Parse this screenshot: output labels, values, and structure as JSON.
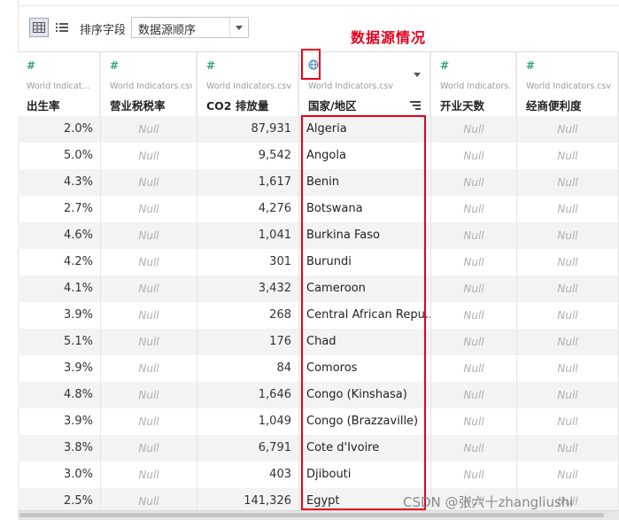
{
  "toolbar": {
    "sort_label": "排序字段",
    "sort_value": "数据源顺序"
  },
  "annotation": "数据源情况",
  "columns": [
    {
      "key": "birth",
      "type_icon": "#",
      "source": "World Indicat...",
      "name": "出生率"
    },
    {
      "key": "tax",
      "type_icon": "#",
      "source": "World Indicators.csv",
      "name": "营业税税率"
    },
    {
      "key": "co2",
      "type_icon": "#",
      "source": "World Indicators.csv",
      "name": "CO2 排放量"
    },
    {
      "key": "country",
      "type_icon": "globe",
      "source": "World Indicators.csv",
      "name": "国家/地区"
    },
    {
      "key": "days",
      "type_icon": "#",
      "source": "World Indicators....",
      "name": "开业天数"
    },
    {
      "key": "ease",
      "type_icon": "#",
      "source": "World Indicators.csv",
      "name": "经商便利度"
    }
  ],
  "rows": [
    {
      "birth": "2.0%",
      "tax": "Null",
      "co2": "87,931",
      "country": "Algeria",
      "days": "Null",
      "ease": "Null"
    },
    {
      "birth": "5.0%",
      "tax": "Null",
      "co2": "9,542",
      "country": "Angola",
      "days": "Null",
      "ease": "Null"
    },
    {
      "birth": "4.3%",
      "tax": "Null",
      "co2": "1,617",
      "country": "Benin",
      "days": "Null",
      "ease": "Null"
    },
    {
      "birth": "2.7%",
      "tax": "Null",
      "co2": "4,276",
      "country": "Botswana",
      "days": "Null",
      "ease": "Null"
    },
    {
      "birth": "4.6%",
      "tax": "Null",
      "co2": "1,041",
      "country": "Burkina Faso",
      "days": "Null",
      "ease": "Null"
    },
    {
      "birth": "4.2%",
      "tax": "Null",
      "co2": "301",
      "country": "Burundi",
      "days": "Null",
      "ease": "Null"
    },
    {
      "birth": "4.1%",
      "tax": "Null",
      "co2": "3,432",
      "country": "Cameroon",
      "days": "Null",
      "ease": "Null"
    },
    {
      "birth": "3.9%",
      "tax": "Null",
      "co2": "268",
      "country": "Central African Repu...",
      "days": "Null",
      "ease": "Null"
    },
    {
      "birth": "5.1%",
      "tax": "Null",
      "co2": "176",
      "country": "Chad",
      "days": "Null",
      "ease": "Null"
    },
    {
      "birth": "3.9%",
      "tax": "Null",
      "co2": "84",
      "country": "Comoros",
      "days": "Null",
      "ease": "Null"
    },
    {
      "birth": "4.8%",
      "tax": "Null",
      "co2": "1,646",
      "country": "Congo (Kinshasa)",
      "days": "Null",
      "ease": "Null"
    },
    {
      "birth": "3.9%",
      "tax": "Null",
      "co2": "1,049",
      "country": "Congo (Brazzaville)",
      "days": "Null",
      "ease": "Null"
    },
    {
      "birth": "3.8%",
      "tax": "Null",
      "co2": "6,791",
      "country": "Cote d'Ivoire",
      "days": "Null",
      "ease": "Null"
    },
    {
      "birth": "3.0%",
      "tax": "Null",
      "co2": "403",
      "country": "Djibouti",
      "days": "Null",
      "ease": "Null"
    },
    {
      "birth": "2.5%",
      "tax": "Null",
      "co2": "141,326",
      "country": "Egypt",
      "days": "Null",
      "ease": "Null"
    }
  ],
  "watermark": "CSDN @张六十zhangliushi",
  "colors": {
    "accent_red": "#e8001c",
    "number_icon": "#35a27b",
    "alt_row": "#f3f3f3"
  }
}
